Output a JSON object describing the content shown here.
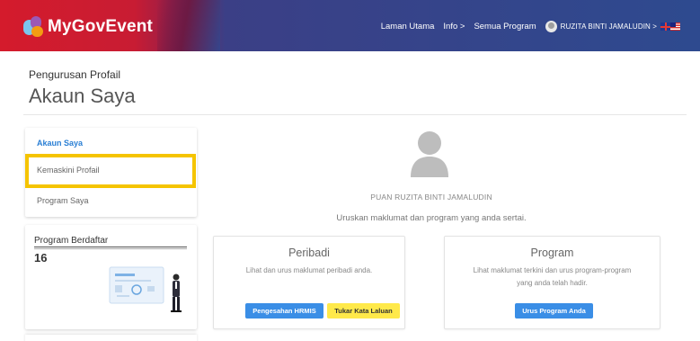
{
  "brand": {
    "name": "MyGovEvent"
  },
  "nav": {
    "home": "Laman Utama",
    "info": "Info >",
    "programs": "Semua Program",
    "user": "RUZITA BINTI JAMALUDIN >",
    "language_icon": "uk-malaysia-flag-icon"
  },
  "header": {
    "section": "Pengurusan Profail",
    "title": "Akaun Saya"
  },
  "sidebar": {
    "items": [
      {
        "label": "Akaun Saya",
        "active": true
      },
      {
        "label": "Kemaskini Profail",
        "active": false
      },
      {
        "label": "Program Saya",
        "active": false
      }
    ],
    "highlight_color": "#f5c400"
  },
  "registered": {
    "title": "Program Berdaftar",
    "count": "16"
  },
  "profile": {
    "name": "PUAN RUZITA BINTI JAMALUDIN",
    "description": "Uruskan maklumat dan program yang anda sertai."
  },
  "panels": {
    "personal": {
      "title": "Peribadi",
      "description": "Lihat dan urus maklumat peribadi anda.",
      "btn_hrmis": "Pengesahan HRMIS",
      "btn_password": "Tukar Kata Laluan"
    },
    "program": {
      "title": "Program",
      "description": "Lihat maklumat terkini dan urus program-program yang anda telah hadir.",
      "btn_manage": "Urus Program Anda"
    }
  },
  "colors": {
    "primary_button": "#3a8ee6",
    "warning_button": "#ffe94a",
    "link_active": "#2a7fd4"
  }
}
